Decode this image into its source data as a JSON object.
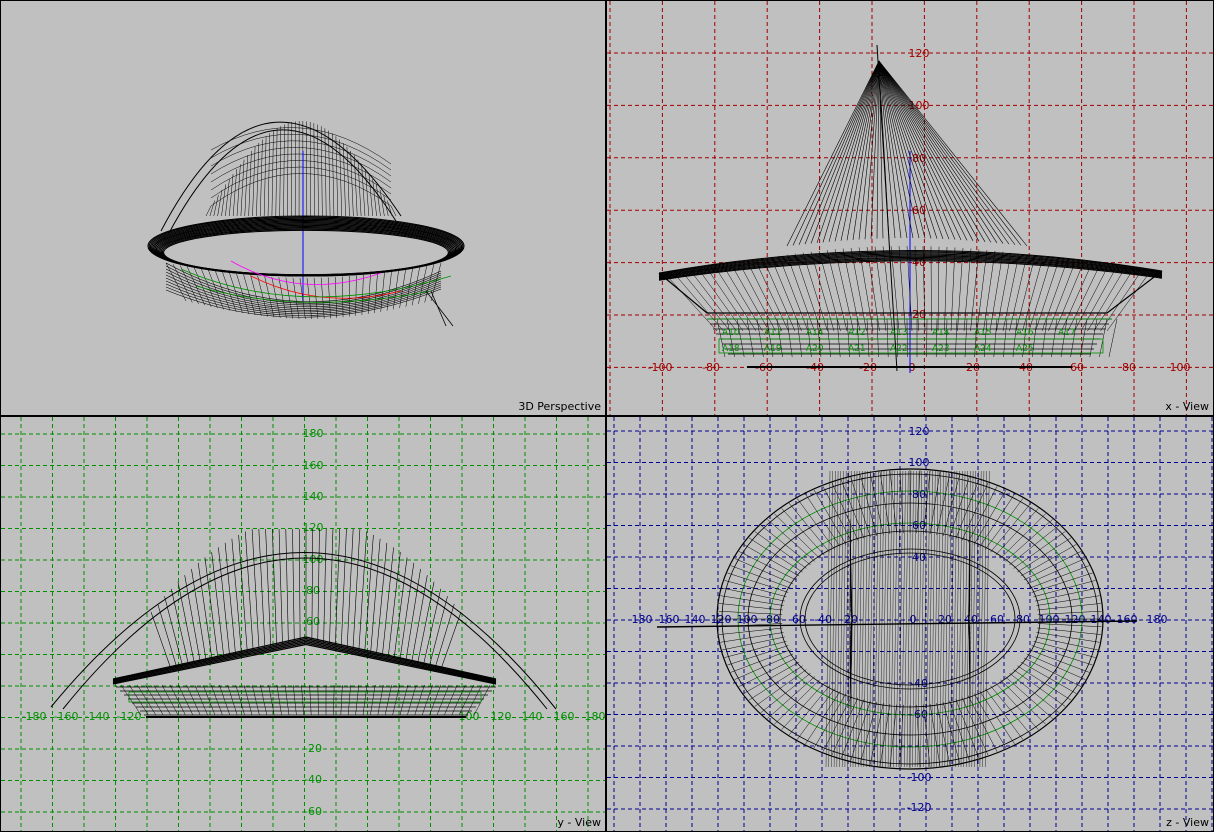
{
  "viewports": {
    "perspective": {
      "label": "3D Perspective"
    },
    "x": {
      "label": "x - View",
      "grid_color": "#a00000",
      "horizontal_ticks": [
        "-100",
        "-80",
        "-60",
        "-40",
        "-20",
        "0",
        "20",
        "40",
        "60",
        "80",
        "100"
      ],
      "vertical_ticks": [
        "120",
        "100",
        "80",
        "60",
        "40",
        "20"
      ],
      "member_labels": [
        "A10",
        "A12",
        "A14",
        "A12",
        "A13",
        "A14",
        "A15",
        "A16",
        "A17",
        "A18",
        "A19",
        "A20",
        "A21",
        "A22",
        "A23",
        "A24",
        "A25"
      ]
    },
    "y": {
      "label": "y - View",
      "grid_color": "#009000",
      "horizontal_ticks": [
        "-180",
        "-160",
        "-140",
        "-120",
        "100",
        "120",
        "140",
        "160",
        "180"
      ],
      "vertical_ticks": [
        "180",
        "160",
        "140",
        "120",
        "100",
        "80",
        "60",
        "-20",
        "-40",
        "-60"
      ]
    },
    "z": {
      "label": "z - View",
      "grid_color": "#000090",
      "horizontal_ticks": [
        "-180",
        "-160",
        "-140",
        "-120",
        "-100",
        "-80",
        "-60",
        "-40",
        "-20",
        "0",
        "20",
        "40",
        "60",
        "80",
        "100",
        "120",
        "140",
        "160",
        "180"
      ],
      "vertical_ticks": [
        "120",
        "100",
        "80",
        "60",
        "40",
        "-40",
        "-60",
        "-100",
        "-120"
      ]
    }
  },
  "colors": {
    "background": "#c0c0c0",
    "structure": "#000000",
    "member_label": "#009000",
    "axis_blue": "#0000ff",
    "highlight_magenta": "#ff00ff",
    "highlight_red": "#ff0000"
  }
}
